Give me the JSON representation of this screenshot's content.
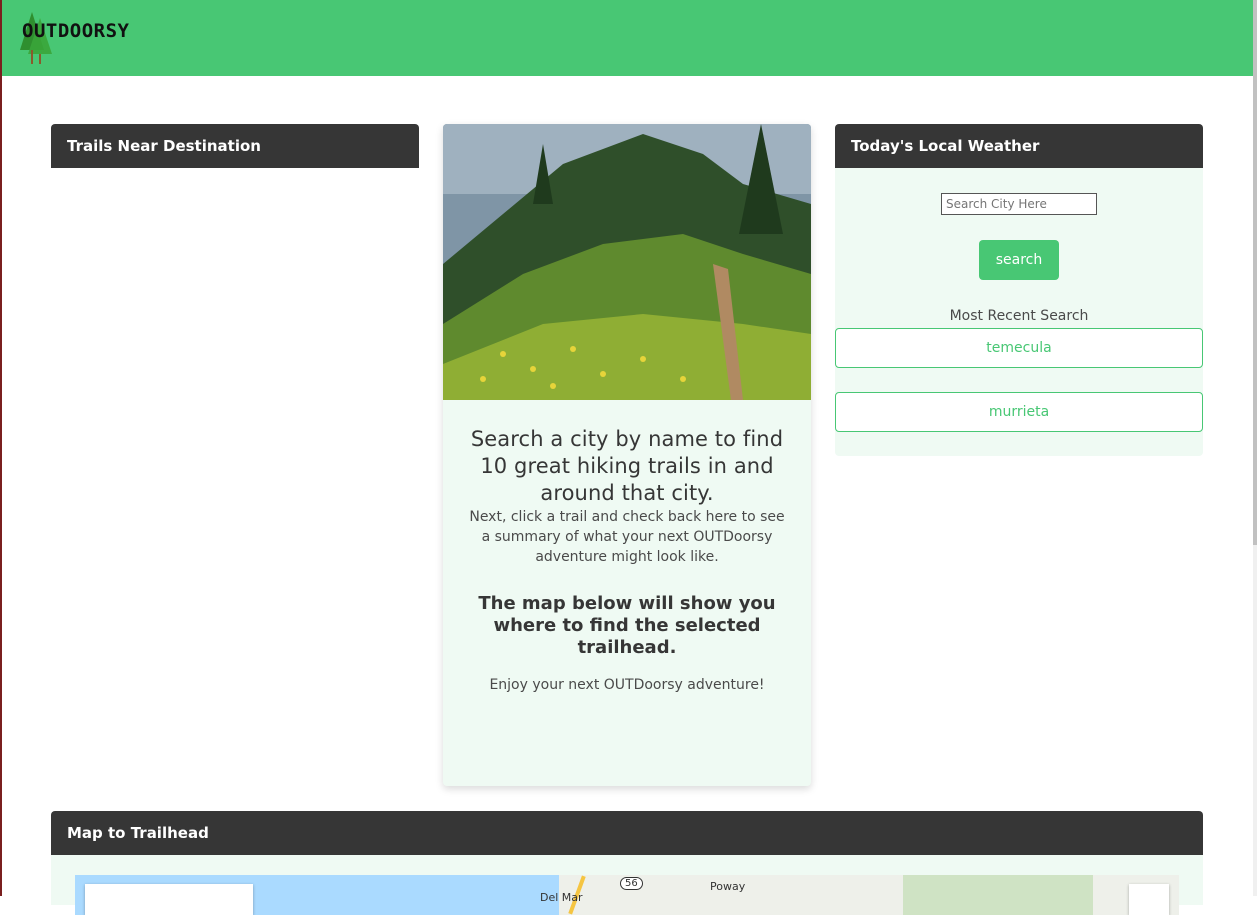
{
  "brand": {
    "logo_text": "OUTDOORSY"
  },
  "trails": {
    "header": "Trails Near Destination"
  },
  "intro": {
    "title": "Search a city by name to find 10 great hiking trails in and around that city.",
    "text": "Next, click a trail and check back here to see a summary of what your next OUTDoorsy adventure might look like.",
    "map_note": "The map below will show you where to find the selected trailhead.",
    "enjoy": "Enjoy your next OUTDoorsy adventure!"
  },
  "weather": {
    "header": "Today's Local Weather",
    "search_placeholder": "Search City Here",
    "search_button": "search",
    "recent_label": "Most Recent Search",
    "recent": [
      "temecula",
      "murrieta"
    ]
  },
  "map": {
    "header": "Map to Trailhead",
    "labels": [
      "Del Mar",
      "56",
      "Poway"
    ]
  },
  "colors": {
    "brand_green": "#48c774",
    "header_dark": "#363636",
    "panel_bg": "#effaf3"
  }
}
